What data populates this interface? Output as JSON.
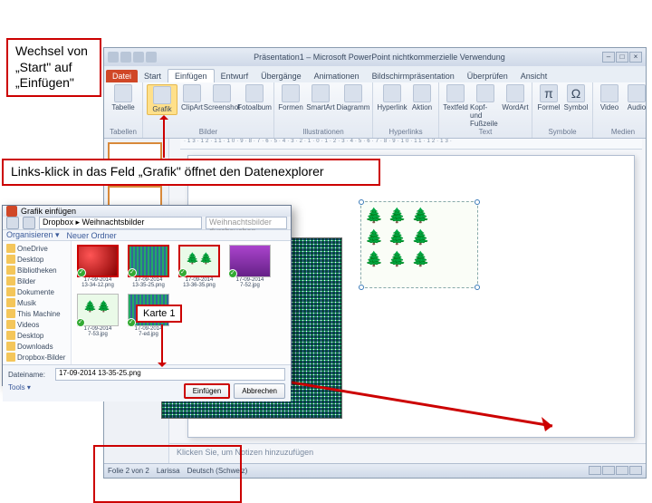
{
  "callouts": {
    "tab_switch": "Wechsel von „Start\" auf „Einfügen\"",
    "grafik_click": "Links-klick in das Feld „Grafik\" öffnet den Datenexplorer",
    "karte": "Karte 1"
  },
  "app": {
    "title": "Präsentation1 – Microsoft PowerPoint nichtkommerzielle Verwendung",
    "tabs": {
      "file": "Datei",
      "start": "Start",
      "einfuegen": "Einfügen",
      "entwurf": "Entwurf",
      "uebergaenge": "Übergänge",
      "animationen": "Animationen",
      "bildschirm": "Bildschirmpräsentation",
      "ueberpruefen": "Überprüfen",
      "ansicht": "Ansicht"
    },
    "ribbon": {
      "tabelle": "Tabelle",
      "grafik": "Grafik",
      "clipart": "ClipArt",
      "screenshot": "Screenshot",
      "fotoalbum": "Fotoalbum",
      "formen": "Formen",
      "smartart": "SmartArt",
      "diagramm": "Diagramm",
      "hyperlink": "Hyperlink",
      "aktion": "Aktion",
      "textfeld": "Textfeld",
      "kopfzeile": "Kopf- und Fußzeile",
      "wordart": "WordArt",
      "formel": "Formel",
      "symbol": "Symbol",
      "video": "Video",
      "audio": "Audio",
      "g_tabellen": "Tabellen",
      "g_bilder": "Bilder",
      "g_illustrationen": "Illustrationen",
      "g_hyperlinks": "Hyperlinks",
      "g_text": "Text",
      "g_symbole": "Symbole",
      "g_medien": "Medien"
    },
    "ruler": "·13·12·11·10·9·8·7·6·5·4·3·2·1·0·1·2·3·4·5·6·7·8·9·10·11·12·13·",
    "notes_placeholder": "Klicken Sie, um Notizen hinzuzufügen",
    "status": {
      "slide": "Folie 2 von 2",
      "author": "Larissa",
      "lang": "Deutsch (Schweiz)"
    }
  },
  "dialog": {
    "title": "Grafik einfügen",
    "path": "Dropbox ▸ Weihnachtsbilder",
    "search_placeholder": "Weihnachtsbilder durchsuchen",
    "organize": "Organisieren ▾",
    "newfolder": "Neuer Ordner",
    "sidebar": [
      "OneDrive",
      "Desktop",
      "Bibliotheken",
      "Bilder",
      "Dokumente",
      "Musik",
      "This Machine",
      "Videos",
      "Desktop",
      "Downloads",
      "Dropbox-Bilder"
    ],
    "files": [
      {
        "name": "17-09-2014",
        "sub": "13-34-12.png",
        "cls": "red"
      },
      {
        "name": "17-09-2014",
        "sub": "13-35-25.png",
        "cls": "grid"
      },
      {
        "name": "17-09-2014",
        "sub": "13-36-35.png",
        "cls": "trees"
      },
      {
        "name": "17-09-2014",
        "sub": "7-52.jpg",
        "cls": "pur"
      },
      {
        "name": "17-09-2014",
        "sub": "7-53.jpg",
        "cls": "trees"
      },
      {
        "name": "17-09-2014",
        "sub": "7-ed.jpg",
        "cls": "grid"
      }
    ],
    "filename_label": "Dateiname:",
    "filename_value": "17-09-2014 13-35-25.png",
    "tools": "Tools ▾",
    "insert": "Einfügen",
    "cancel": "Abbrechen"
  }
}
